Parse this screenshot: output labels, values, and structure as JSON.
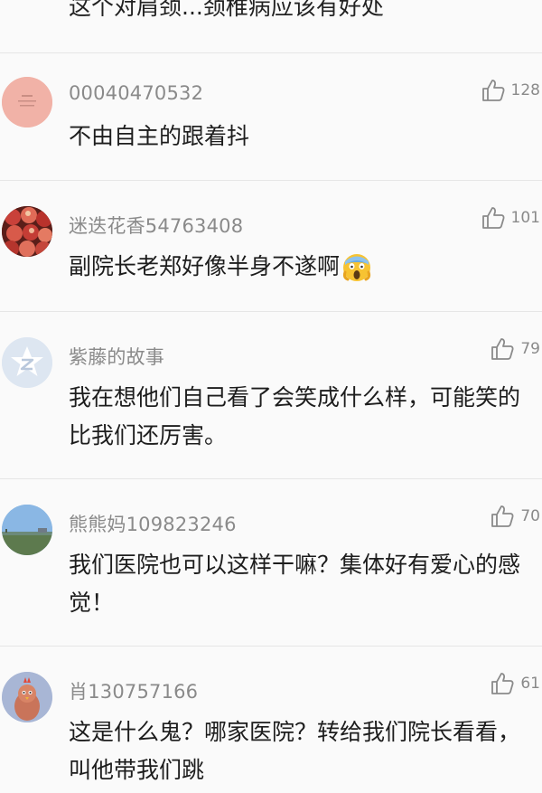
{
  "partial_top_text": "这个对肩颈...颈椎病应该有好处",
  "comments": [
    {
      "username": "00040470532",
      "content": "不由自主的跟着抖",
      "likes": "128",
      "avatar": "pink-circle-avatar"
    },
    {
      "username": "迷迭花香54763408",
      "content": "副院长老郑好像半身不遂啊",
      "likes": "101",
      "avatar": "apples-avatar",
      "emoji": "screaming-face-emoji"
    },
    {
      "username": "紫藤的故事",
      "content": "我在想他们自己看了会笑成什么样，可能笑的比我们还厉害。",
      "likes": "79",
      "avatar": "default-star-avatar"
    },
    {
      "username": "熊熊妈109823246",
      "content": "我们医院也可以这样干嘛？集体好有爱心的感觉！",
      "likes": "70",
      "avatar": "landscape-avatar"
    },
    {
      "username": "肖130757166",
      "content": "这是什么鬼？哪家医院？转给我们院长看看，叫他带我们跳",
      "likes": "61",
      "avatar": "cartoon-bird-avatar"
    }
  ],
  "colors": {
    "background": "#fafafa",
    "username": "#8a8a8a",
    "divider": "#e6e6e6",
    "text": "#1d1d1d"
  },
  "icons": {
    "like": "thumbs-up-icon"
  }
}
